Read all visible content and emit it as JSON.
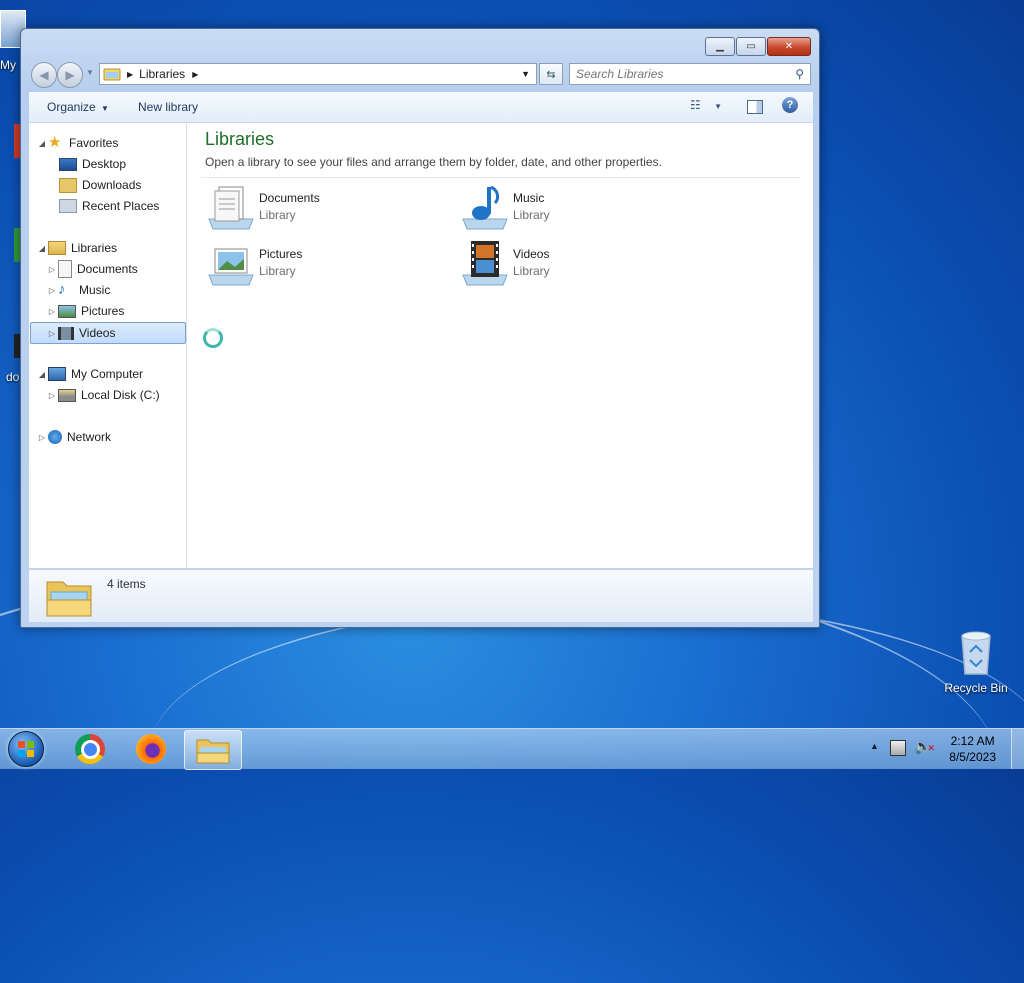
{
  "desktop": {
    "left_icon_fragments": [
      "My",
      "do"
    ],
    "recycle_bin_label": "Recycle Bin"
  },
  "window": {
    "address_path": "Libraries",
    "search_placeholder": "Search Libraries",
    "toolbar": {
      "organize": "Organize",
      "new_library": "New library"
    },
    "nav": {
      "favorites": "Favorites",
      "desktop": "Desktop",
      "downloads": "Downloads",
      "recent_places": "Recent Places",
      "libraries": "Libraries",
      "documents": "Documents",
      "music": "Music",
      "pictures": "Pictures",
      "videos": "Videos",
      "my_computer": "My Computer",
      "local_disk": "Local Disk (C:)",
      "network": "Network"
    },
    "content": {
      "title": "Libraries",
      "subtitle": "Open a library to see your files and arrange them by folder, date, and other properties.",
      "libraries": [
        {
          "name": "Documents",
          "type": "Library",
          "icon": "documents-library-icon"
        },
        {
          "name": "Music",
          "type": "Library",
          "icon": "music-library-icon"
        },
        {
          "name": "Pictures",
          "type": "Library",
          "icon": "pictures-library-icon"
        },
        {
          "name": "Videos",
          "type": "Library",
          "icon": "videos-library-icon"
        }
      ]
    },
    "status": {
      "item_count": "4 items"
    }
  },
  "taskbar": {
    "time": "2:12 AM",
    "date": "8/5/2023",
    "apps": [
      "start-orb",
      "chrome",
      "firefox",
      "windows-explorer"
    ]
  }
}
